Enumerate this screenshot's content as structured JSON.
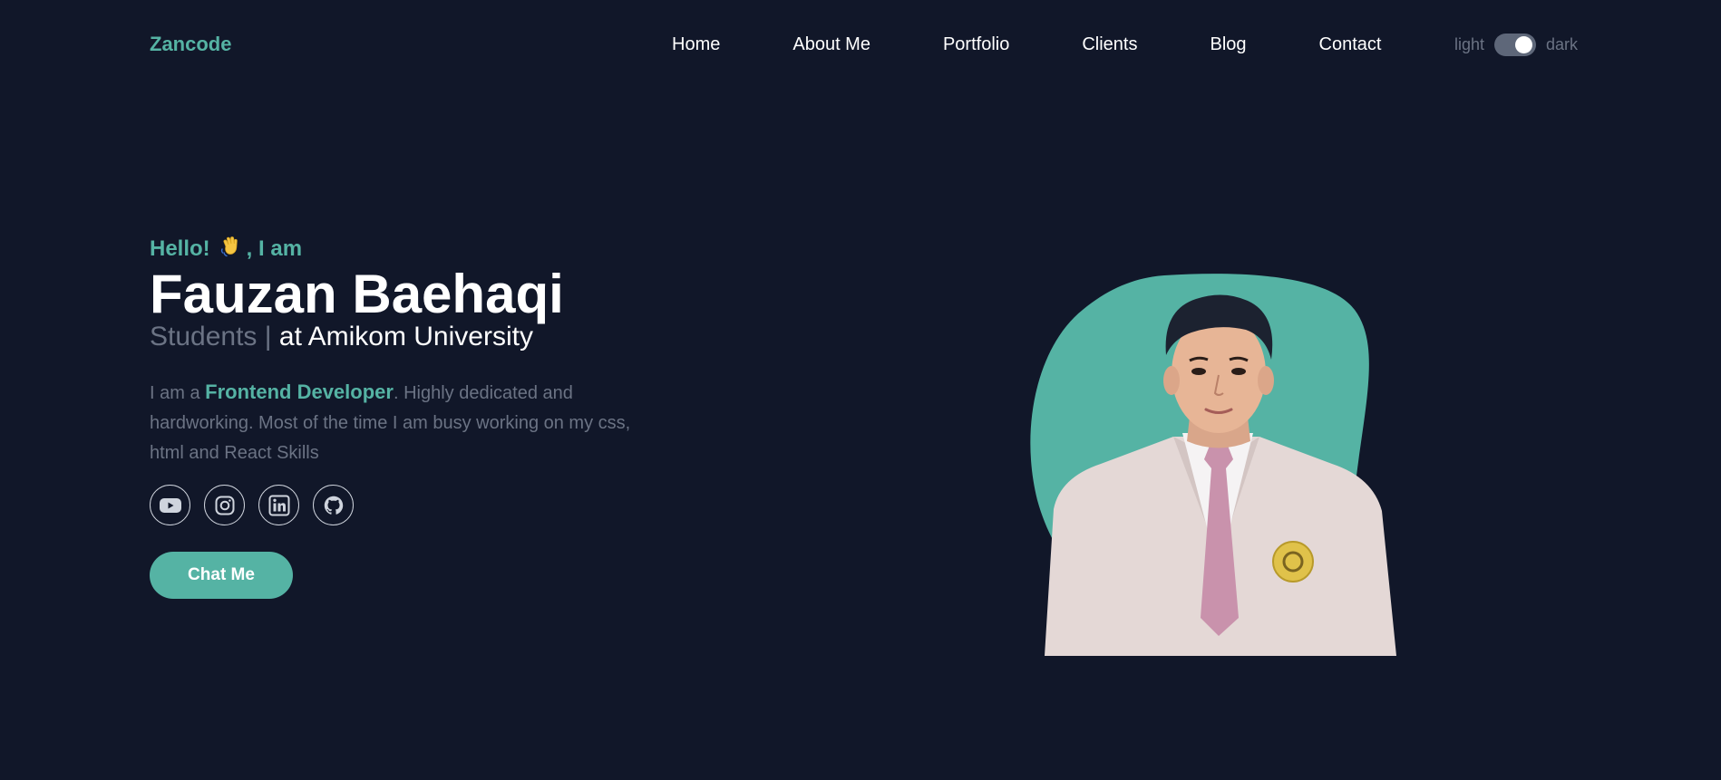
{
  "nav": {
    "logo": "Zancode",
    "items": [
      {
        "label": "Home"
      },
      {
        "label": "About Me"
      },
      {
        "label": "Portfolio"
      },
      {
        "label": "Clients"
      },
      {
        "label": "Blog"
      },
      {
        "label": "Contact"
      }
    ],
    "theme": {
      "light_label": "light",
      "dark_label": "dark",
      "mode": "dark"
    }
  },
  "hero": {
    "greeting_prefix": "Hello!",
    "greeting_suffix": ", I am",
    "greeting_icon": "waving-hand-icon",
    "name": "Fauzan Baehaqi",
    "role_muted": "Students |",
    "role_main": "at Amikom University",
    "desc_prefix": "I am a",
    "desc_highlight": "Frontend Developer",
    "desc_rest": ". Highly dedicated and hardworking. Most of the time I am busy working on my css, html and React Skills",
    "socials": [
      {
        "icon": "youtube-icon"
      },
      {
        "icon": "instagram-icon"
      },
      {
        "icon": "linkedin-icon"
      },
      {
        "icon": "github-icon"
      }
    ],
    "cta_label": "Chat Me"
  },
  "colors": {
    "background": "#111729",
    "accent": "#55b3a4",
    "muted": "#6b7384",
    "text": "#ffffff"
  }
}
